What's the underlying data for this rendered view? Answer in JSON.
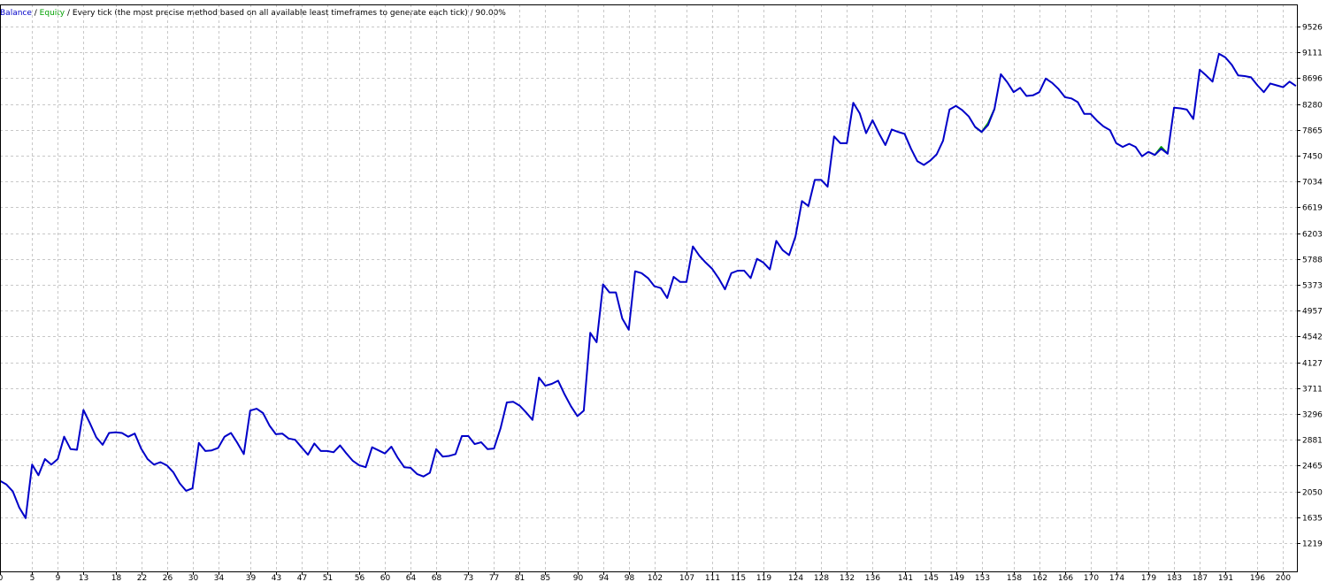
{
  "legend": {
    "balance_label": "Balance",
    "separator_1": " / ",
    "equity_label": "Equity",
    "separator_2": " / ",
    "method_text": "Every tick (the most precise method based on all available least timeframes to generate each tick)",
    "separator_3": " / ",
    "quality_text": "90.00%"
  },
  "colors": {
    "balance": "#0000c8",
    "equity": "#00a000",
    "grid": "#c8c8c8",
    "frame": "#000000",
    "background": "#ffffff"
  },
  "chart_data": {
    "type": "line",
    "title": "",
    "xlabel": "",
    "ylabel": "",
    "grid": true,
    "xlim": [
      0,
      205
    ],
    "ylim": [
      1219,
      9733
    ],
    "x_ticks": [
      0,
      5,
      9,
      13,
      18,
      22,
      26,
      30,
      34,
      39,
      43,
      47,
      51,
      56,
      60,
      64,
      68,
      73,
      77,
      81,
      85,
      90,
      94,
      98,
      102,
      107,
      111,
      115,
      119,
      124,
      128,
      132,
      136,
      141,
      145,
      149,
      153,
      158,
      162,
      166,
      170,
      174,
      179,
      183,
      187,
      191,
      196,
      200
    ],
    "y_ticks": [
      1219,
      1635,
      2050,
      2465,
      2881,
      3296,
      3711,
      4127,
      4542,
      4957,
      5373,
      5788,
      6203,
      6619,
      7034,
      7450,
      7865,
      8280,
      8696,
      9111,
      9526
    ],
    "series": [
      {
        "name": "Balance",
        "points": [
          [
            0,
            2220
          ],
          [
            1,
            2160
          ],
          [
            2,
            2050
          ],
          [
            3,
            1790
          ],
          [
            4,
            1620
          ],
          [
            5,
            2480
          ],
          [
            6,
            2310
          ],
          [
            7,
            2570
          ],
          [
            8,
            2480
          ],
          [
            9,
            2570
          ],
          [
            10,
            2930
          ],
          [
            11,
            2730
          ],
          [
            12,
            2720
          ],
          [
            13,
            3360
          ],
          [
            14,
            3150
          ],
          [
            15,
            2920
          ],
          [
            16,
            2800
          ],
          [
            17,
            2990
          ],
          [
            18,
            3000
          ],
          [
            19,
            2990
          ],
          [
            20,
            2930
          ],
          [
            21,
            2980
          ],
          [
            22,
            2740
          ],
          [
            23,
            2570
          ],
          [
            24,
            2480
          ],
          [
            25,
            2520
          ],
          [
            26,
            2470
          ],
          [
            27,
            2360
          ],
          [
            28,
            2180
          ],
          [
            29,
            2060
          ],
          [
            30,
            2100
          ],
          [
            31,
            2830
          ],
          [
            32,
            2700
          ],
          [
            33,
            2710
          ],
          [
            34,
            2750
          ],
          [
            35,
            2930
          ],
          [
            36,
            2990
          ],
          [
            37,
            2830
          ],
          [
            38,
            2650
          ],
          [
            39,
            3350
          ],
          [
            40,
            3380
          ],
          [
            41,
            3310
          ],
          [
            42,
            3110
          ],
          [
            43,
            2970
          ],
          [
            44,
            2980
          ],
          [
            45,
            2900
          ],
          [
            46,
            2880
          ],
          [
            47,
            2760
          ],
          [
            48,
            2640
          ],
          [
            49,
            2820
          ],
          [
            50,
            2700
          ],
          [
            51,
            2700
          ],
          [
            52,
            2680
          ],
          [
            53,
            2790
          ],
          [
            54,
            2660
          ],
          [
            55,
            2540
          ],
          [
            56,
            2470
          ],
          [
            57,
            2440
          ],
          [
            58,
            2760
          ],
          [
            59,
            2710
          ],
          [
            60,
            2660
          ],
          [
            61,
            2770
          ],
          [
            62,
            2590
          ],
          [
            63,
            2440
          ],
          [
            64,
            2430
          ],
          [
            65,
            2330
          ],
          [
            66,
            2290
          ],
          [
            67,
            2350
          ],
          [
            68,
            2730
          ],
          [
            69,
            2610
          ],
          [
            70,
            2620
          ],
          [
            71,
            2650
          ],
          [
            72,
            2940
          ],
          [
            73,
            2940
          ],
          [
            74,
            2810
          ],
          [
            75,
            2840
          ],
          [
            76,
            2730
          ],
          [
            77,
            2740
          ],
          [
            78,
            3060
          ],
          [
            79,
            3480
          ],
          [
            80,
            3490
          ],
          [
            81,
            3430
          ],
          [
            82,
            3320
          ],
          [
            83,
            3200
          ],
          [
            84,
            3880
          ],
          [
            85,
            3750
          ],
          [
            86,
            3780
          ],
          [
            87,
            3830
          ],
          [
            88,
            3610
          ],
          [
            89,
            3420
          ],
          [
            90,
            3260
          ],
          [
            91,
            3350
          ],
          [
            92,
            4600
          ],
          [
            93,
            4450
          ],
          [
            94,
            5380
          ],
          [
            95,
            5250
          ],
          [
            96,
            5250
          ],
          [
            97,
            4830
          ],
          [
            98,
            4650
          ],
          [
            99,
            5590
          ],
          [
            100,
            5560
          ],
          [
            101,
            5480
          ],
          [
            102,
            5350
          ],
          [
            103,
            5320
          ],
          [
            104,
            5160
          ],
          [
            105,
            5500
          ],
          [
            106,
            5420
          ],
          [
            107,
            5420
          ],
          [
            108,
            5990
          ],
          [
            109,
            5840
          ],
          [
            110,
            5730
          ],
          [
            111,
            5630
          ],
          [
            112,
            5480
          ],
          [
            113,
            5300
          ],
          [
            114,
            5560
          ],
          [
            115,
            5600
          ],
          [
            116,
            5600
          ],
          [
            117,
            5480
          ],
          [
            118,
            5790
          ],
          [
            119,
            5730
          ],
          [
            120,
            5620
          ],
          [
            121,
            6080
          ],
          [
            122,
            5930
          ],
          [
            123,
            5850
          ],
          [
            124,
            6150
          ],
          [
            125,
            6720
          ],
          [
            126,
            6640
          ],
          [
            127,
            7060
          ],
          [
            128,
            7060
          ],
          [
            129,
            6950
          ],
          [
            130,
            7760
          ],
          [
            131,
            7650
          ],
          [
            132,
            7650
          ],
          [
            133,
            8300
          ],
          [
            134,
            8130
          ],
          [
            135,
            7810
          ],
          [
            136,
            8020
          ],
          [
            137,
            7810
          ],
          [
            138,
            7620
          ],
          [
            139,
            7870
          ],
          [
            140,
            7830
          ],
          [
            141,
            7800
          ],
          [
            142,
            7560
          ],
          [
            143,
            7360
          ],
          [
            144,
            7300
          ],
          [
            145,
            7370
          ],
          [
            146,
            7470
          ],
          [
            147,
            7690
          ],
          [
            148,
            8190
          ],
          [
            149,
            8250
          ],
          [
            150,
            8180
          ],
          [
            151,
            8080
          ],
          [
            152,
            7910
          ],
          [
            153,
            7830
          ],
          [
            154,
            7940
          ],
          [
            155,
            8200
          ],
          [
            156,
            8760
          ],
          [
            157,
            8630
          ],
          [
            158,
            8470
          ],
          [
            159,
            8540
          ],
          [
            160,
            8410
          ],
          [
            161,
            8420
          ],
          [
            162,
            8470
          ],
          [
            163,
            8690
          ],
          [
            164,
            8620
          ],
          [
            165,
            8520
          ],
          [
            166,
            8390
          ],
          [
            167,
            8370
          ],
          [
            168,
            8310
          ],
          [
            169,
            8120
          ],
          [
            170,
            8120
          ],
          [
            171,
            8010
          ],
          [
            172,
            7920
          ],
          [
            173,
            7860
          ],
          [
            174,
            7650
          ],
          [
            175,
            7590
          ],
          [
            176,
            7640
          ],
          [
            177,
            7590
          ],
          [
            178,
            7440
          ],
          [
            179,
            7510
          ],
          [
            180,
            7460
          ],
          [
            181,
            7560
          ],
          [
            182,
            7480
          ],
          [
            183,
            8220
          ],
          [
            184,
            8210
          ],
          [
            185,
            8190
          ],
          [
            186,
            8040
          ],
          [
            187,
            8830
          ],
          [
            188,
            8740
          ],
          [
            189,
            8640
          ],
          [
            190,
            9090
          ],
          [
            191,
            9030
          ],
          [
            192,
            8910
          ],
          [
            193,
            8740
          ],
          [
            194,
            8730
          ],
          [
            195,
            8710
          ],
          [
            196,
            8580
          ],
          [
            197,
            8470
          ],
          [
            198,
            8610
          ],
          [
            199,
            8580
          ],
          [
            200,
            8550
          ],
          [
            201,
            8640
          ],
          [
            202,
            8570
          ]
        ]
      },
      {
        "name": "Equity",
        "points": [
          [
            152,
            7910
          ],
          [
            153,
            7830
          ],
          [
            154,
            7970
          ],
          [
            155,
            8200
          ],
          [
            180,
            7460
          ],
          [
            181,
            7590
          ],
          [
            182,
            7480
          ]
        ]
      }
    ]
  }
}
